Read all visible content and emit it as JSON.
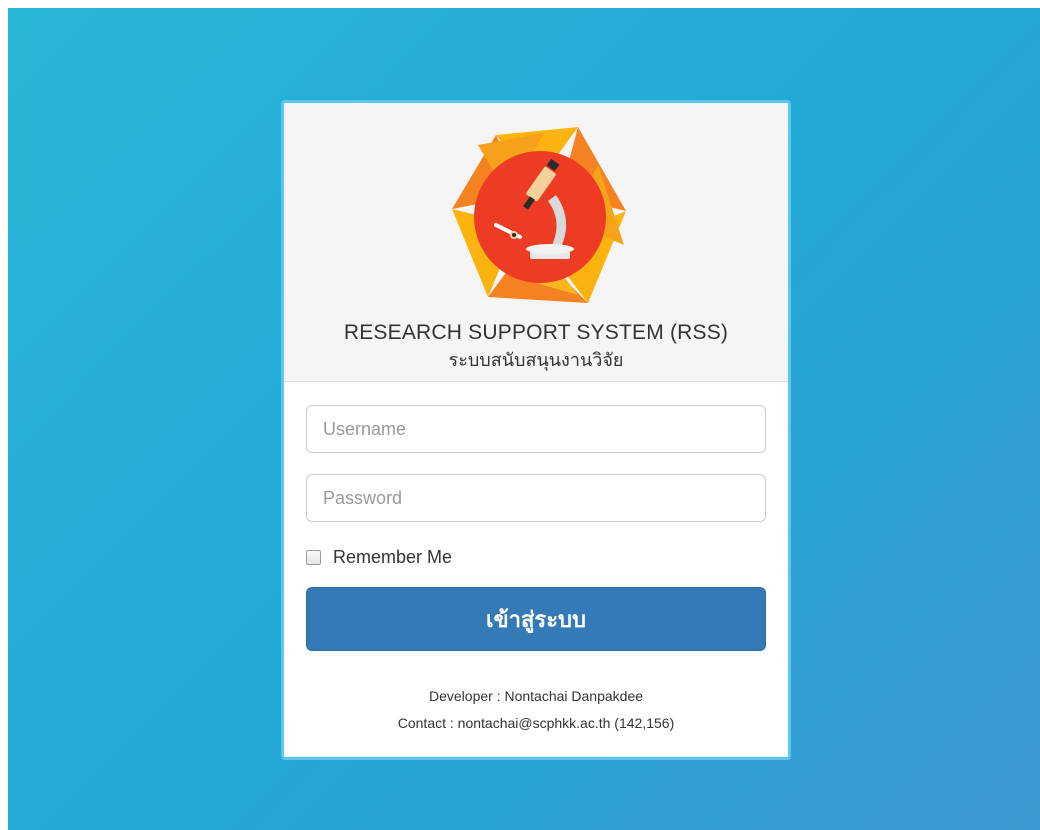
{
  "app": {
    "title_en": "RESEARCH SUPPORT SYSTEM (RSS)",
    "title_th": "ระบบสนับสนุนงานวิจัย",
    "logo_icon": "microscope-logo-icon"
  },
  "form": {
    "username_placeholder": "Username",
    "password_placeholder": "Password",
    "username_value": "",
    "password_value": "",
    "remember_label": "Remember Me",
    "remember_checked": false,
    "login_label": "เข้าสู่ระบบ"
  },
  "footer": {
    "developer": "Developer : Nontachai Danpakdee",
    "contact": "Contact : nontachai@scphkk.ac.th (142,156)"
  },
  "colors": {
    "background_start": "#28b6d6",
    "background_end": "#3b97cf",
    "card_border": "#5cc7f2",
    "primary_button": "#337ab7",
    "logo_red": "#ee3b24",
    "logo_orange": "#f58220",
    "logo_yellow": "#fbb40f"
  }
}
